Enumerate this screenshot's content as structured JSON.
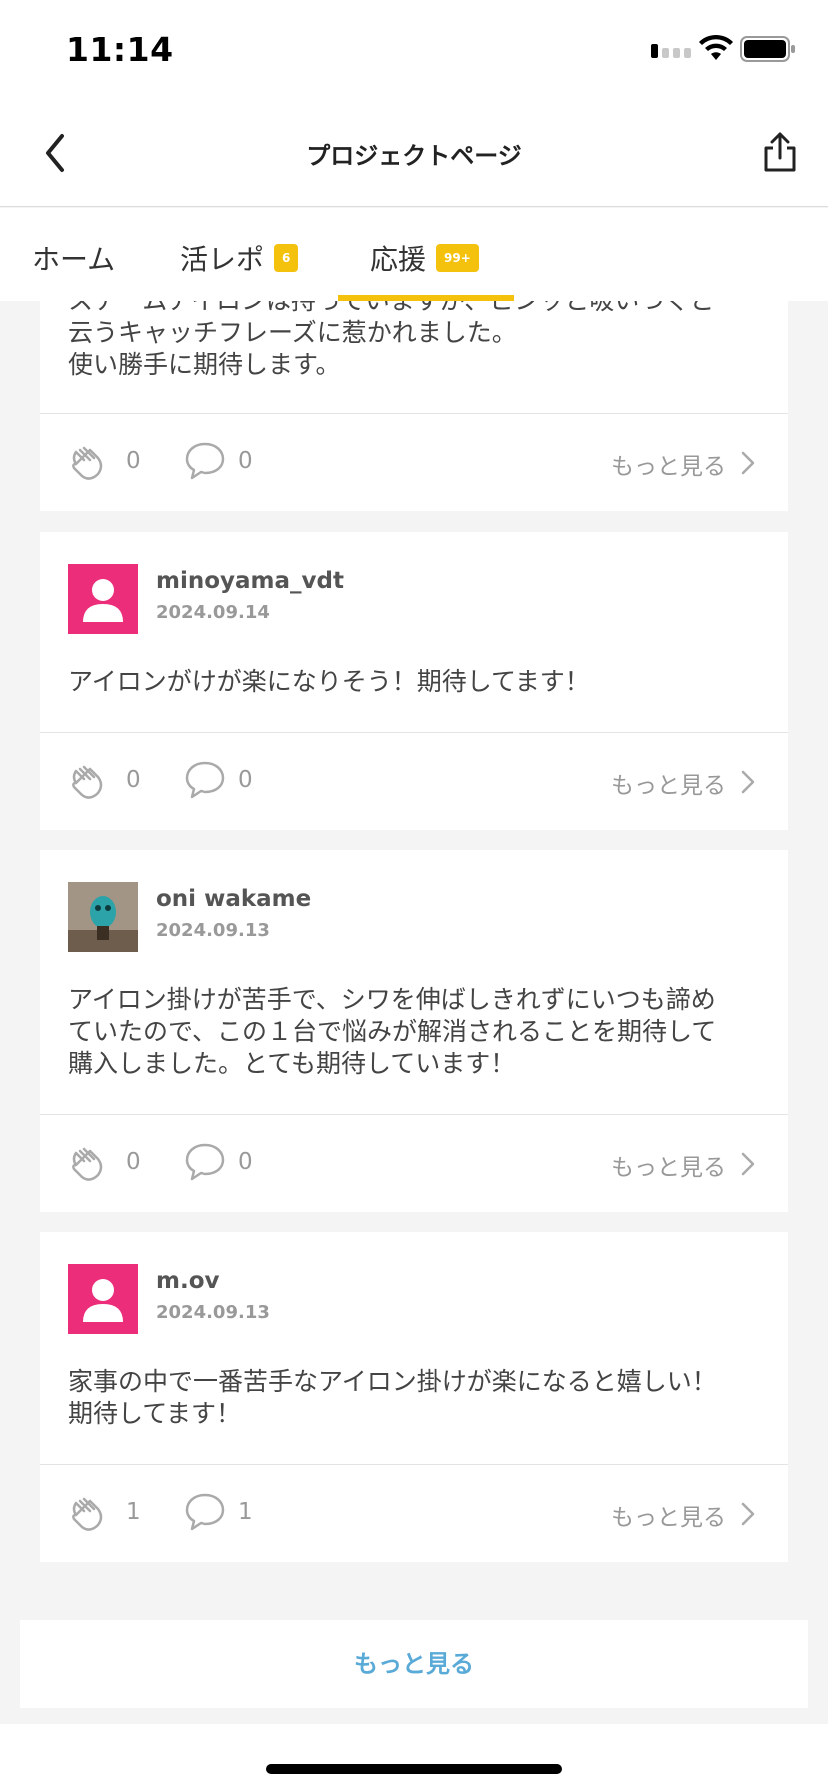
{
  "status_bar": {
    "time": "11:14"
  },
  "nav": {
    "title": "プロジェクトページ"
  },
  "tabs": [
    {
      "label": "ホーム",
      "badge": ""
    },
    {
      "label": "活レポ",
      "badge": "6"
    },
    {
      "label": "応援",
      "badge": "99+"
    }
  ],
  "posts": [
    {
      "user": "",
      "date": "",
      "text_lines": [
        "スチームアイロンは持っていますが、ピンッと吸いつくと",
        "云うキャッチフレーズに惹かれました。",
        "使い勝手に期待します。"
      ],
      "claps": "0",
      "comments": "0",
      "more_label": "もっと見る"
    },
    {
      "user": "minoyama_vdt",
      "date": "2024.09.14",
      "text_lines": [
        "アイロンがけが楽になりそう！期待してます！"
      ],
      "claps": "0",
      "comments": "0",
      "more_label": "もっと見る"
    },
    {
      "user": "oni wakame",
      "date": "2024.09.13",
      "text_lines": [
        "アイロン掛けが苦手で、シワを伸ばしきれずにいつも諦め",
        "ていたので、この１台で悩みが解消されることを期待して",
        "購入しました。とても期待しています！"
      ],
      "claps": "0",
      "comments": "0",
      "more_label": "もっと見る"
    },
    {
      "user": "m.ov",
      "date": "2024.09.13",
      "text_lines": [
        "家事の中で一番苦手なアイロン掛けが楽になると嬉しい！",
        "期待してます！"
      ],
      "claps": "1",
      "comments": "1",
      "more_label": "もっと見る"
    }
  ],
  "load_more": "もっと見る",
  "colors": {
    "accent": "#f4c20d",
    "avatar_default": "#ec2d7a",
    "link": "#5aaad8"
  }
}
